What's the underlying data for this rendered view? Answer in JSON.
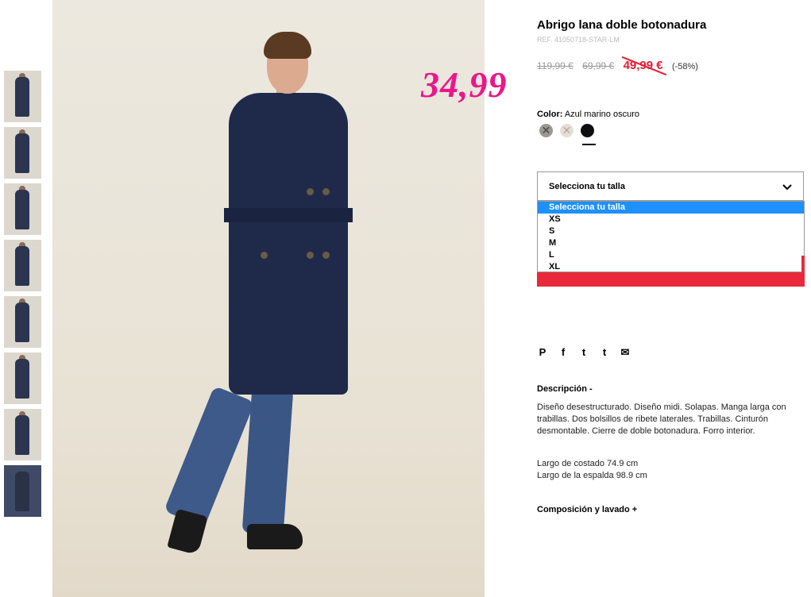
{
  "product": {
    "title": "Abrigo lana doble botonadura",
    "ref": "REF. 41050718-STAR-LM",
    "prices": {
      "old1": "119,99 €",
      "old2": "69,99 €",
      "current": "49,99 €",
      "discount": "(-58%)"
    },
    "promo_price": "34,99",
    "color_label": "Color:",
    "color_value": "Azul marino oscuro",
    "swatches": [
      {
        "name": "grey",
        "color": "#9b9891",
        "unavailable": true
      },
      {
        "name": "beige",
        "color": "#e9ddd3",
        "unavailable": true
      },
      {
        "name": "black",
        "color": "#0e0e12",
        "selected": true
      }
    ],
    "size_select": {
      "placeholder": "Selecciona tu talla",
      "options": [
        "Selecciona tu talla",
        "XS",
        "S",
        "M",
        "L",
        "XL"
      ],
      "highlighted": 0
    },
    "description_header": "Descripción -",
    "description": "Diseño desestructurado. Diseño midi. Solapas. Manga larga con trabillas. Dos bolsillos de ribete laterales. Trabillas. Cinturón desmontable. Cierre de doble botonadura. Forro interior.",
    "measure1": "Largo de costado 74.9 cm",
    "measure2": "Largo de la espalda 98.9 cm",
    "composition_header": "Composición y lavado +"
  },
  "social": {
    "pinterest": "P",
    "facebook": "f",
    "twitter": "t",
    "tumblr": "t",
    "mail": "✉"
  },
  "colors": {
    "accent": "#e51c32",
    "promo": "#ec168c",
    "highlight": "#1e90ff"
  }
}
